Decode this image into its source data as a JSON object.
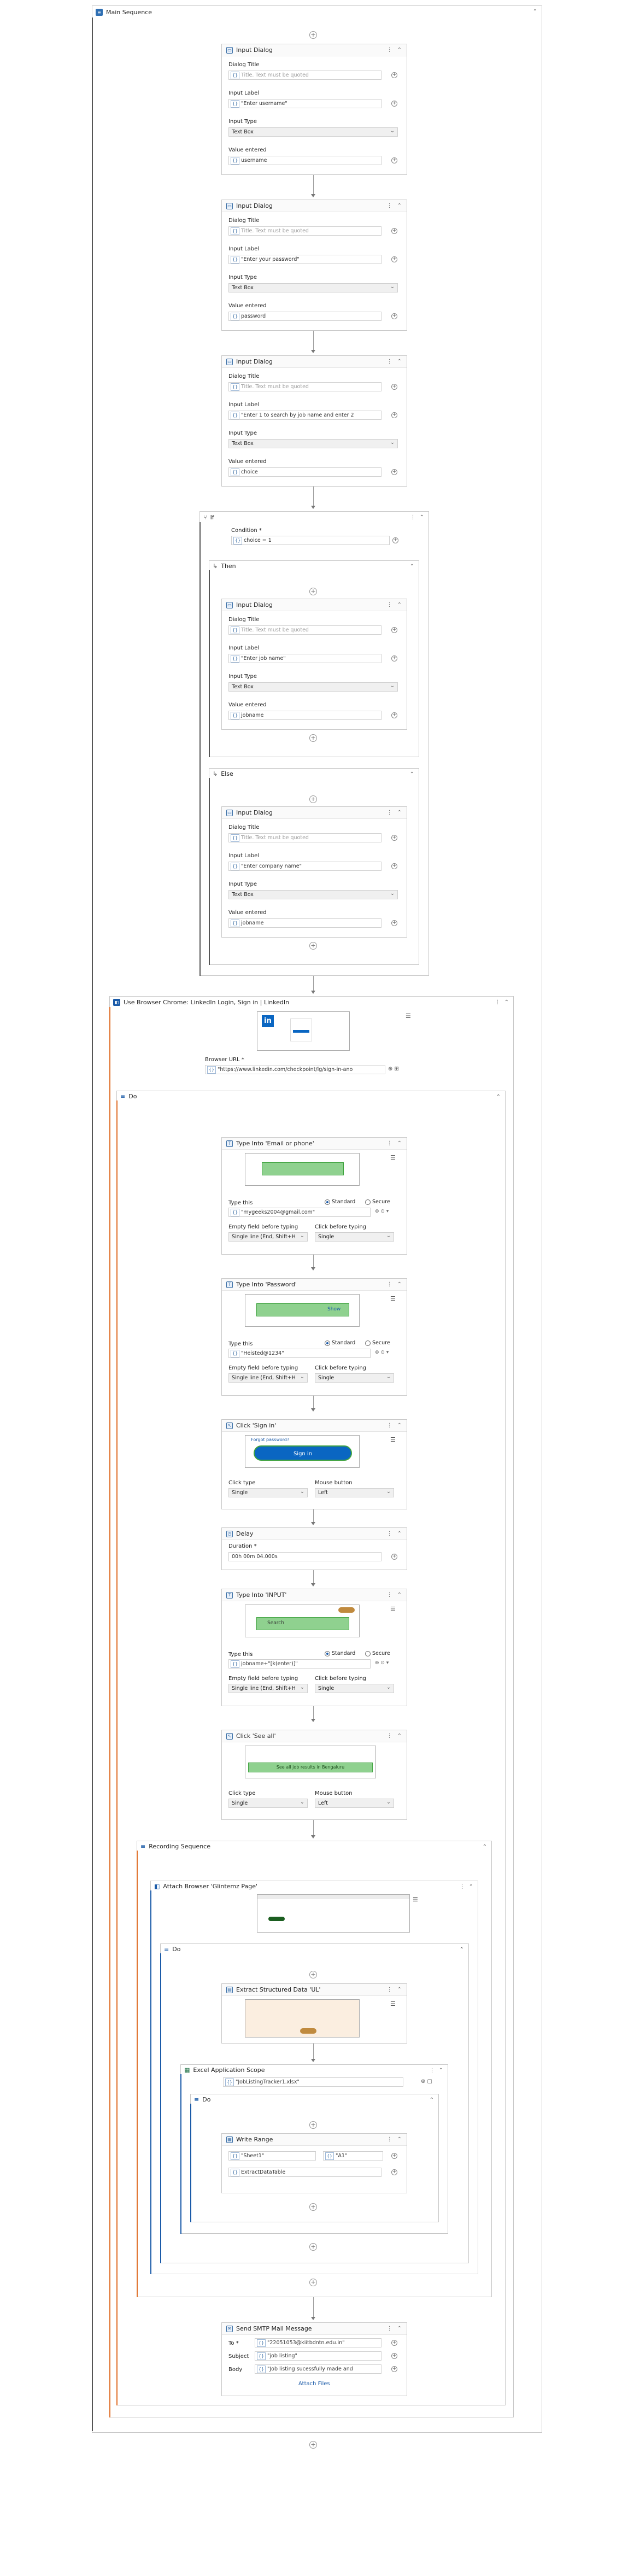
{
  "main_sequence": {
    "title": "Main Sequence"
  },
  "common": {
    "dialog_title_label": "Dialog Title",
    "dialog_title_placeholder": "Title. Text must be quoted",
    "input_label_label": "Input Label",
    "input_type_label": "Input Type",
    "input_type_value": "Text Box",
    "value_entered_label": "Value entered",
    "type_this_label": "Type this",
    "standard_label": "Standard",
    "secure_label": "Secure",
    "empty_field_label": "Empty field before typing",
    "empty_field_value": "Single line (End, Shift+H",
    "click_before_label": "Click before typing",
    "click_before_value": "Single",
    "click_type_label": "Click type",
    "click_type_value": "Single",
    "mouse_button_label": "Mouse button",
    "mouse_button_value": "Left"
  },
  "dialogs": [
    {
      "title": "Input Dialog",
      "input_label": "\"Enter username\"",
      "value": "username"
    },
    {
      "title": "Input Dialog",
      "input_label": "\"Enter your password\"",
      "value": "password"
    },
    {
      "title": "Input Dialog",
      "input_label": "\"Enter 1 to search by job name and enter 2",
      "value": "choice"
    }
  ],
  "if_block": {
    "title": "If",
    "condition_label": "Condition *",
    "condition_value": "choice = 1",
    "then_label": "Then",
    "else_label": "Else",
    "then_dialog": {
      "title": "Input Dialog",
      "input_label": "\"Enter job name\"",
      "value": "jobname"
    },
    "else_dialog": {
      "title": "Input Dialog",
      "input_label": "\"Enter company name\"",
      "value": "jobname"
    }
  },
  "browser": {
    "title": "Use Browser Chrome: LinkedIn Login, Sign in | LinkedIn",
    "url_label": "Browser URL *",
    "url_value": "\"https://www.linkedin.com/checkpoint/lg/sign-in-ano",
    "do_label": "Do"
  },
  "type_email": {
    "title": "Type Into 'Email or phone'",
    "value": "\"mygeeks2004@gmail.com\""
  },
  "type_password": {
    "title": "Type Into 'Password'",
    "value": "\"Heisted@1234\"",
    "shot_text": "Show"
  },
  "click_signin": {
    "title": "Click 'Sign in'",
    "shot_text": "Sign in",
    "shot_caption": "Forgot password?"
  },
  "delay": {
    "title": "Delay",
    "duration_label": "Duration *",
    "duration_value": "00h 00m 04.000s"
  },
  "type_input": {
    "title": "Type Into 'INPUT'",
    "value": "jobname+\"[k(enter)]\"",
    "shot_text": "Search"
  },
  "click_see_all": {
    "title": "Click 'See all'",
    "shot_text": "See all job results in Bengaluru"
  },
  "recording": {
    "title": "Recording Sequence"
  },
  "attach": {
    "title": "Attach Browser 'Glintemz Page'",
    "do_label": "Do"
  },
  "extract": {
    "title": "Extract Structured Data 'UL'"
  },
  "excel": {
    "title": "Excel Application Scope",
    "path": "\"JobListingTracker1.xlsx\"",
    "do_label": "Do"
  },
  "write_range": {
    "title": "Write Range",
    "sheet": "\"Sheet1\"",
    "cell": "\"A1\"",
    "table": "ExtractDataTable"
  },
  "smtp": {
    "title": "Send SMTP Mail Message",
    "to_label": "To *",
    "to_value": "\"22051053@kiitbdntn.edu.in\"",
    "subject_label": "Subject",
    "subject_value": "\"job listing\"",
    "body_label": "Body",
    "body_value": "\"Job listing sucessfully made and",
    "attach_link": "Attach Files"
  },
  "colors": {
    "accent": "#1a5aa8",
    "orange": "#e0702a",
    "green": "#8fd18f",
    "linkedin": "#0a66c2"
  }
}
